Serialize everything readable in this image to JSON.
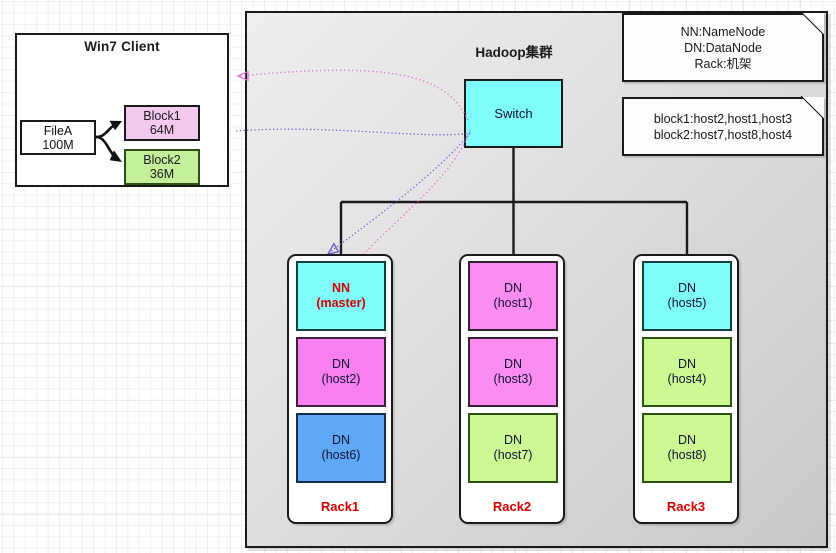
{
  "client": {
    "title": "Win7 Client",
    "file": {
      "name": "FileA",
      "size": "100M"
    },
    "blocks": [
      {
        "name": "Block1",
        "size": "64M"
      },
      {
        "name": "Block2",
        "size": "36M"
      }
    ]
  },
  "hadoop": {
    "title": "Hadoop集群",
    "switch_label": "Switch",
    "notes": [
      {
        "lines": [
          "NN:NameNode",
          "DN:DataNode",
          "Rack:机架"
        ]
      },
      {
        "lines": [
          "block1:host2,host1,host3",
          "block2:host7,host8,host4"
        ]
      }
    ],
    "racks": [
      {
        "label": "Rack1",
        "nodes": [
          {
            "role": "NN",
            "host": "(master)",
            "color": "cyan",
            "is_master": true
          },
          {
            "role": "DN",
            "host": "(host2)",
            "color": "magenta",
            "is_master": false
          },
          {
            "role": "DN",
            "host": "(host6)",
            "color": "blue",
            "is_master": false
          }
        ]
      },
      {
        "label": "Rack2",
        "nodes": [
          {
            "role": "DN",
            "host": "(host1)",
            "color": "pink",
            "is_master": false
          },
          {
            "role": "DN",
            "host": "(host3)",
            "color": "pink",
            "is_master": false
          },
          {
            "role": "DN",
            "host": "(host7)",
            "color": "green",
            "is_master": false
          }
        ]
      },
      {
        "label": "Rack3",
        "nodes": [
          {
            "role": "DN",
            "host": "(host5)",
            "color": "cyan",
            "is_master": false
          },
          {
            "role": "DN",
            "host": "(host4)",
            "color": "green",
            "is_master": false
          },
          {
            "role": "DN",
            "host": "(host8)",
            "color": "green",
            "is_master": false
          }
        ]
      }
    ]
  },
  "colors": {
    "cyan": "#7ffcfc",
    "magenta": "#f77ff0",
    "pink": "#fd8cf2",
    "green": "#ccf994",
    "blue": "#5ea8f5",
    "block1": "#f5c8f0",
    "block2": "#c4ef9b",
    "rack_label": "#d40000",
    "wire_pink": "#e07ad0",
    "wire_blue": "#6a5fd0",
    "panel_border": "#1a1a1a"
  }
}
